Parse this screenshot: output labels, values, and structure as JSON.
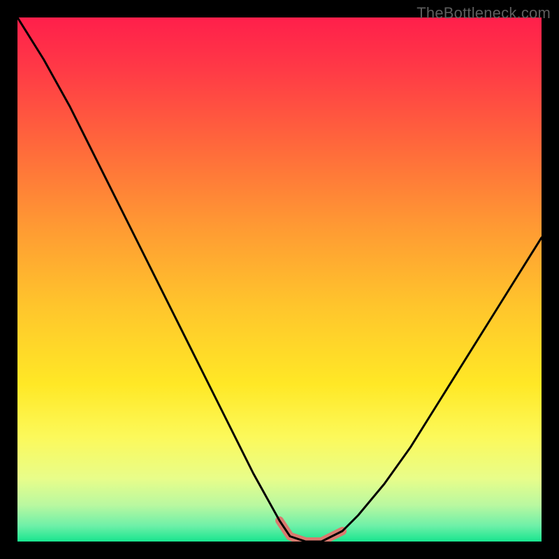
{
  "watermark": "TheBottleneck.com",
  "chart_data": {
    "type": "line",
    "title": "",
    "xlabel": "",
    "ylabel": "",
    "xlim": [
      0,
      100
    ],
    "ylim": [
      0,
      100
    ],
    "series": [
      {
        "name": "bottleneck-curve",
        "x": [
          0,
          5,
          10,
          15,
          20,
          25,
          30,
          35,
          40,
          45,
          50,
          52,
          55,
          58,
          60,
          62,
          65,
          70,
          75,
          80,
          85,
          90,
          95,
          100
        ],
        "values": [
          100,
          92,
          83,
          73,
          63,
          53,
          43,
          33,
          23,
          13,
          4,
          1,
          0,
          0,
          1,
          2,
          5,
          11,
          18,
          26,
          34,
          42,
          50,
          58
        ]
      },
      {
        "name": "highlight-segment",
        "x": [
          50,
          52,
          55,
          58,
          60,
          62
        ],
        "values": [
          4,
          1,
          0,
          0,
          1,
          2
        ]
      }
    ],
    "gradient_stops": [
      {
        "offset": 0.0,
        "color": "#ff1f4b"
      },
      {
        "offset": 0.1,
        "color": "#ff3a46"
      },
      {
        "offset": 0.25,
        "color": "#ff6a3b"
      },
      {
        "offset": 0.4,
        "color": "#ff9a33"
      },
      {
        "offset": 0.55,
        "color": "#ffc52c"
      },
      {
        "offset": 0.7,
        "color": "#ffe826"
      },
      {
        "offset": 0.8,
        "color": "#fcf95a"
      },
      {
        "offset": 0.88,
        "color": "#e8fd8a"
      },
      {
        "offset": 0.93,
        "color": "#baf8a0"
      },
      {
        "offset": 0.97,
        "color": "#6ef0a8"
      },
      {
        "offset": 1.0,
        "color": "#18e58f"
      }
    ],
    "curve_stroke": "#000000",
    "highlight_stroke": "#d97a6f",
    "highlight_width": 12,
    "curve_width": 3
  }
}
